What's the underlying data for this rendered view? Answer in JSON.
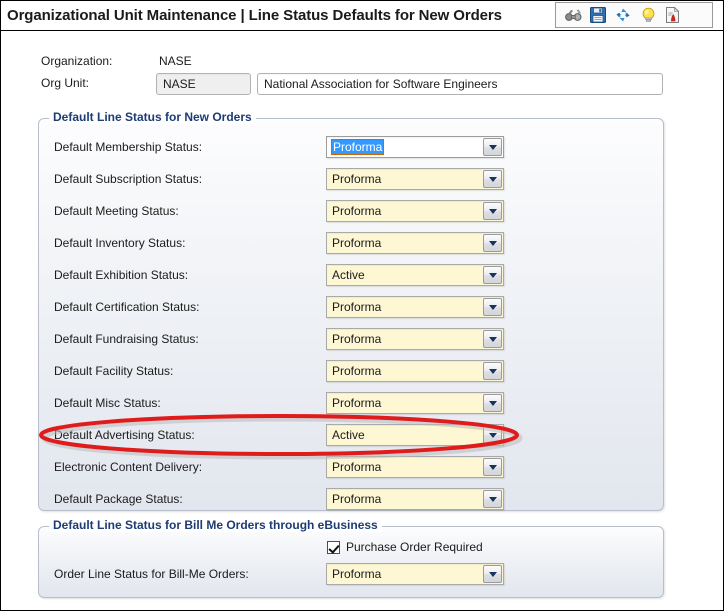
{
  "window": {
    "title": "Organizational Unit Maintenance | Line Status Defaults for New Orders"
  },
  "toolbar": {
    "icons": [
      {
        "name": "binoculars-icon",
        "label": "Find"
      },
      {
        "name": "save-icon",
        "label": "Save"
      },
      {
        "name": "refresh-icon",
        "label": "Refresh"
      },
      {
        "name": "lightbulb-icon",
        "label": "Hints"
      },
      {
        "name": "report-icon",
        "label": "Report"
      }
    ]
  },
  "header": {
    "organization_label": "Organization:",
    "organization_value": "NASE",
    "org_unit_label": "Org Unit:",
    "org_unit_code": "NASE",
    "org_unit_name": "National Association for Software Engineers"
  },
  "new_orders_group": {
    "legend": "Default Line Status for New Orders",
    "rows": [
      {
        "label": "Default Membership Status:",
        "value": "Proforma",
        "focused": true
      },
      {
        "label": "Default Subscription Status:",
        "value": "Proforma",
        "focused": false
      },
      {
        "label": "Default Meeting Status:",
        "value": "Proforma",
        "focused": false
      },
      {
        "label": "Default Inventory Status:",
        "value": "Proforma",
        "focused": false
      },
      {
        "label": "Default Exhibition Status:",
        "value": "Active",
        "focused": false
      },
      {
        "label": "Default Certification Status:",
        "value": "Proforma",
        "focused": false
      },
      {
        "label": "Default Fundraising Status:",
        "value": "Proforma",
        "focused": false
      },
      {
        "label": "Default Facility Status:",
        "value": "Proforma",
        "focused": false
      },
      {
        "label": "Default Misc Status:",
        "value": "Proforma",
        "focused": false
      },
      {
        "label": "Default Advertising Status:",
        "value": "Active",
        "focused": false
      },
      {
        "label": "Electronic Content Delivery:",
        "value": "Proforma",
        "focused": false
      },
      {
        "label": "Default Package Status:",
        "value": "Proforma",
        "focused": false
      }
    ]
  },
  "bill_me_group": {
    "legend": "Default Line Status for Bill Me Orders through eBusiness",
    "purchase_order_required_label": "Purchase Order Required",
    "purchase_order_required_checked": true,
    "order_line_status_label": "Order Line Status for Bill-Me Orders:",
    "order_line_status_value": "Proforma"
  },
  "annotation": {
    "shape": "ellipse",
    "color": "#e01b1b",
    "target": "Default Advertising Status:"
  },
  "colors": {
    "legend_text": "#1d3c74",
    "combo_background": "#fdf7d4",
    "selection_highlight": "#3399ff",
    "annotation_red": "#e01b1b"
  }
}
